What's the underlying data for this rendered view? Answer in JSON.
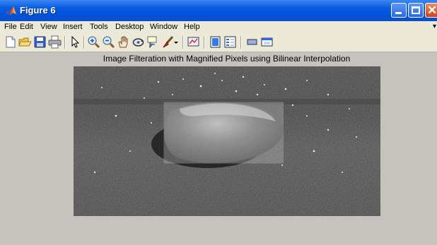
{
  "window": {
    "title": "Figure 6"
  },
  "menu": [
    {
      "label": "File"
    },
    {
      "label": "Edit"
    },
    {
      "label": "View"
    },
    {
      "label": "Insert"
    },
    {
      "label": "Tools"
    },
    {
      "label": "Desktop"
    },
    {
      "label": "Window"
    },
    {
      "label": "Help"
    }
  ],
  "toolbar": [
    {
      "icon": "new-figure-icon"
    },
    {
      "icon": "open-file-icon"
    },
    {
      "icon": "save-figure-icon"
    },
    {
      "icon": "print-figure-icon"
    },
    {
      "icon": "edit-plot-arrow-icon"
    },
    {
      "icon": "zoom-in-icon"
    },
    {
      "icon": "zoom-out-icon"
    },
    {
      "icon": "pan-hand-icon"
    },
    {
      "icon": "rotate-3d-icon"
    },
    {
      "icon": "data-cursor-icon"
    },
    {
      "icon": "brush-icon"
    },
    {
      "icon": "link-plot-icon"
    },
    {
      "icon": "colorbar-icon"
    },
    {
      "icon": "legend-icon"
    },
    {
      "icon": "hide-plot-tools-icon"
    },
    {
      "icon": "show-plot-tools-icon"
    }
  ],
  "figure": {
    "title": "Image Filteration with Magnified Pixels using Bilinear Interpolation"
  },
  "colors": {
    "titlebar": "#0052d8",
    "chrome": "#ece9d8",
    "figure_bg": "#c6c3be",
    "close_button": "#d0411c"
  }
}
